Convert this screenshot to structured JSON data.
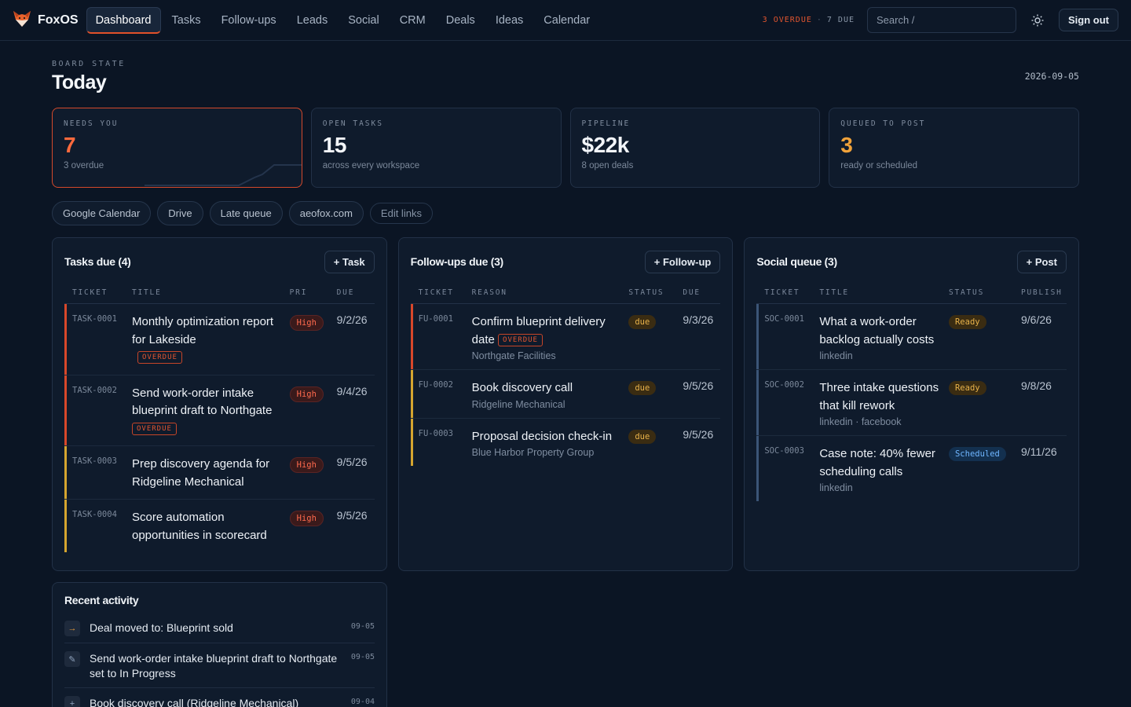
{
  "app": {
    "name": "FoxOS",
    "accent": "#e2512a"
  },
  "nav": [
    "Dashboard",
    "Tasks",
    "Follow-ups",
    "Leads",
    "Social",
    "CRM",
    "Deals",
    "Ideas",
    "Calendar"
  ],
  "topbar": {
    "overdue_label": "3 OVERDUE",
    "due_label": "7 DUE",
    "separator": "·",
    "search_placeholder": "Search  /",
    "sign_out": "Sign out"
  },
  "header": {
    "eyebrow": "BOARD STATE",
    "title": "Today",
    "date": "2026-09-05"
  },
  "stats": [
    {
      "label": "NEEDS YOU",
      "value": "7",
      "sub": "3 overdue",
      "color": "#ff6a3d"
    },
    {
      "label": "OPEN TASKS",
      "value": "15",
      "sub": "across every workspace",
      "color": "#f3f6fa"
    },
    {
      "label": "PIPELINE",
      "value": "$22k",
      "sub": "8 open deals",
      "color": "#f3f6fa"
    },
    {
      "label": "QUEUED TO POST",
      "value": "3",
      "sub": "ready or scheduled",
      "color": "#f0a23a"
    }
  ],
  "links": [
    "Google Calendar",
    "Drive",
    "Late queue",
    "aeofox.com"
  ],
  "edit_links": "Edit links",
  "tasks": {
    "title": "Tasks due (4)",
    "add": "+ Task",
    "cols": [
      "TICKET",
      "TITLE",
      "PRI",
      "DUE"
    ],
    "rows": [
      {
        "ticket": "TASK-0001",
        "title": "Monthly optimization report for Lakeside",
        "tag": "OVERDUE",
        "pri": "High",
        "due": "9/2/26"
      },
      {
        "ticket": "TASK-0002",
        "title": "Send work-order intake blueprint draft to Northgate",
        "tag": "OVERDUE",
        "pri": "High",
        "due": "9/4/26"
      },
      {
        "ticket": "TASK-0003",
        "title": "Prep discovery agenda for Ridgeline Mechanical",
        "tag": "",
        "pri": "High",
        "due": "9/5/26"
      },
      {
        "ticket": "TASK-0004",
        "title": "Score automation opportunities in scorecard",
        "tag": "",
        "pri": "High",
        "due": "9/5/26"
      }
    ]
  },
  "followups": {
    "title": "Follow-ups due (3)",
    "add": "+ Follow-up",
    "cols": [
      "TICKET",
      "REASON",
      "STATUS",
      "DUE"
    ],
    "rows": [
      {
        "ticket": "FU-0001",
        "title": "Confirm blueprint delivery date",
        "tag": "OVERDUE",
        "meta": "Northgate Facilities",
        "status": "due",
        "due": "9/3/26"
      },
      {
        "ticket": "FU-0002",
        "title": "Book discovery call",
        "tag": "",
        "meta": "Ridgeline Mechanical",
        "status": "due",
        "due": "9/5/26"
      },
      {
        "ticket": "FU-0003",
        "title": "Proposal decision check-in",
        "tag": "",
        "meta": "Blue Harbor Property Group",
        "status": "due",
        "due": "9/5/26"
      }
    ]
  },
  "social": {
    "title": "Social queue (3)",
    "add": "+ Post",
    "cols": [
      "TICKET",
      "TITLE",
      "STATUS",
      "PUBLISH"
    ],
    "rows": [
      {
        "ticket": "SOC-0001",
        "title": "What a work-order backlog actually costs",
        "meta": "linkedin",
        "status": "Ready",
        "date": "9/6/26"
      },
      {
        "ticket": "SOC-0002",
        "title": "Three intake questions that kill rework",
        "meta": "linkedin · facebook",
        "status": "Ready",
        "date": "9/8/26"
      },
      {
        "ticket": "SOC-0003",
        "title": "Case note: 40% fewer scheduling calls",
        "meta": "linkedin",
        "status": "Scheduled",
        "date": "9/11/26"
      }
    ]
  },
  "activity": {
    "title": "Recent activity",
    "items": [
      {
        "icon": "arrow-right-icon",
        "glyph": "→",
        "text": "Deal moved to: Blueprint sold",
        "time": "09-05"
      },
      {
        "icon": "pencil-icon",
        "glyph": "✎",
        "text": "Send work-order intake blueprint draft to Northgate set to In Progress",
        "time": "09-05"
      },
      {
        "icon": "plus-icon",
        "glyph": "+",
        "text": "Book discovery call (Ridgeline Mechanical)",
        "time": "09-04"
      }
    ]
  }
}
